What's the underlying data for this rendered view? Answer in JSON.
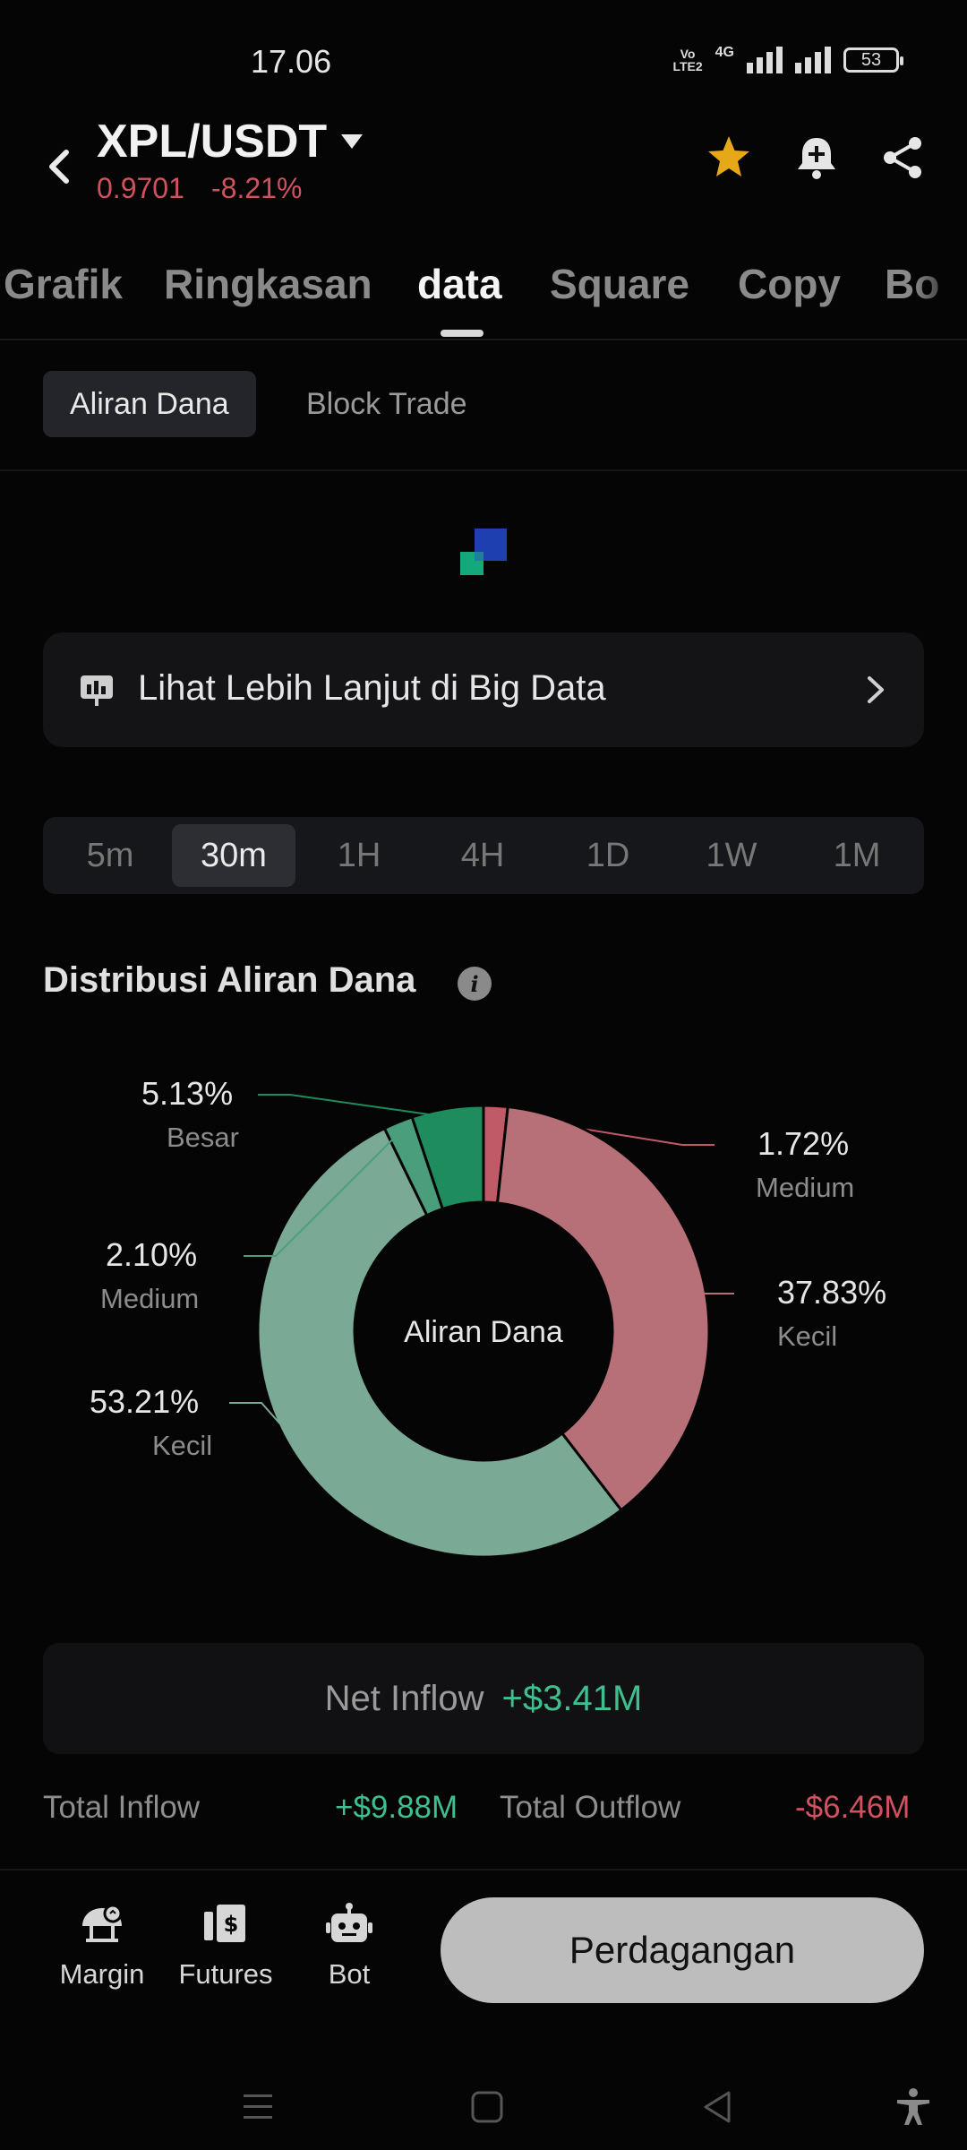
{
  "status_bar": {
    "time": "17.06",
    "volte_top": "Vo",
    "volte_bottom": "LTE2",
    "network": "4G",
    "battery": "53"
  },
  "header": {
    "pair": "XPL/USDT",
    "price": "0.9701",
    "change": "-8.21%",
    "icons": [
      "back-icon",
      "caret-down-icon",
      "star-icon",
      "bell-plus-icon",
      "share-icon"
    ],
    "favorite_color": "#e6a817"
  },
  "tabs": {
    "items": [
      "Grafik",
      "Ringkasan",
      "data",
      "Square",
      "Copy",
      "Bo"
    ],
    "active": "data"
  },
  "subtabs": {
    "items": [
      "Aliran Dana",
      "Block Trade"
    ],
    "active": "Aliran Dana"
  },
  "big_data": {
    "label": "Lihat Lebih Lanjut di Big Data"
  },
  "intervals": {
    "items": [
      "5m",
      "30m",
      "1H",
      "4H",
      "1D",
      "1W",
      "1M"
    ],
    "active": "30m"
  },
  "distribution": {
    "title": "Distribusi Aliran Dana",
    "center_label": "Aliran Dana"
  },
  "chart_data": {
    "type": "pie",
    "title": "Distribusi Aliran Dana",
    "center_label": "Aliran Dana",
    "slices": [
      {
        "label": "Besar",
        "value": 5.13,
        "pct_label": "5.13%",
        "color": "#1e8c5c"
      },
      {
        "label": "Medium",
        "value": 2.1,
        "pct_label": "2.10%",
        "color": "#4a9e7b"
      },
      {
        "label": "Kecil",
        "value": 53.21,
        "pct_label": "53.21%",
        "color": "#7aa995"
      },
      {
        "label": "Medium",
        "value": 1.72,
        "pct_label": "1.72%",
        "color": "#c05a66"
      },
      {
        "label": "Kecil",
        "value": 37.83,
        "pct_label": "37.83%",
        "color": "#b87078"
      }
    ]
  },
  "flows": {
    "net_label": "Net Inflow",
    "net_value": "+$3.41M",
    "total_inflow_label": "Total Inflow",
    "total_inflow_value": "+$9.88M",
    "total_outflow_label": "Total Outflow",
    "total_outflow_value": "-$6.46M"
  },
  "bottom_nav": {
    "items": [
      {
        "label": "Margin",
        "icon": "margin-icon"
      },
      {
        "label": "Futures",
        "icon": "futures-icon"
      },
      {
        "label": "Bot",
        "icon": "bot-icon"
      }
    ],
    "trade_button": "Perdagangan"
  },
  "system_nav": {
    "icons": [
      "recents-icon",
      "home-icon",
      "back-triangle-icon",
      "accessibility-icon"
    ]
  }
}
